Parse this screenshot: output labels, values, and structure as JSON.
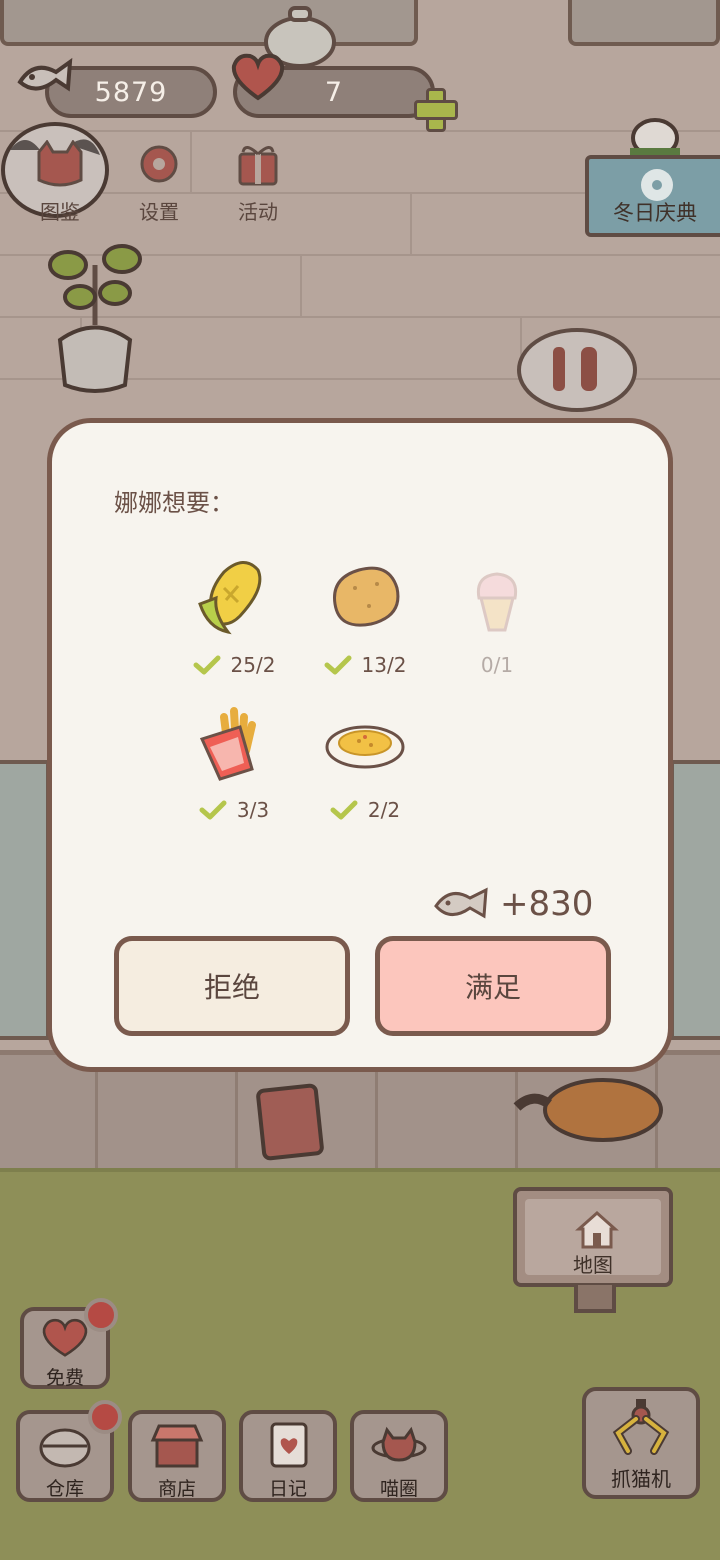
{
  "hud": {
    "fish_currency": "5879",
    "heart_currency": "7"
  },
  "top_menu": {
    "encyclopedia": "图鉴",
    "settings": "设置",
    "events": "活动"
  },
  "event_banner": {
    "label": "冬日庆典"
  },
  "dialog": {
    "title": "娜娜想要：",
    "items": [
      {
        "name": "corn-icon",
        "count": "25/2",
        "fulfilled": true
      },
      {
        "name": "potato-icon",
        "count": "13/2",
        "fulfilled": true
      },
      {
        "name": "ice-cream-icon",
        "count": "0/1",
        "fulfilled": false
      },
      {
        "name": "fries-icon",
        "count": "3/3",
        "fulfilled": true
      },
      {
        "name": "omelette-plate-icon",
        "count": "2/2",
        "fulfilled": true
      }
    ],
    "reward": "+830",
    "refuse_label": "拒绝",
    "accept_label": "满足"
  },
  "map_sign": {
    "label": "地图"
  },
  "bottom_bar": {
    "free": "免费",
    "warehouse": "仓库",
    "shop": "商店",
    "diary": "日记",
    "cat_circle": "喵圈",
    "claw_machine": "抓猫机"
  },
  "colors": {
    "dialog_bg": "#f7f4ee",
    "dialog_border": "#7a5a4d",
    "accept_bg": "#fcc6bd",
    "refuse_bg": "#f5ede0",
    "check_green": "#b5c64c",
    "badge_red": "#b54a44"
  }
}
